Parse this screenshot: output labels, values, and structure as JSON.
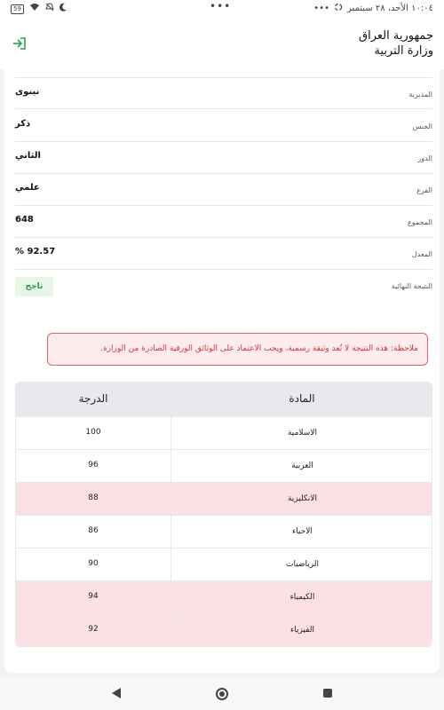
{
  "status_bar": {
    "battery": "59",
    "time_date": "١٠:٠٤ الأحد، ٢٨ سبتمبر",
    "dots": "•••"
  },
  "header": {
    "line1": "جمهورية العراق",
    "line2": "وزارة التربية"
  },
  "info": [
    {
      "label": "المديرية",
      "value": "نينوى"
    },
    {
      "label": "الجنس",
      "value": "ذكر"
    },
    {
      "label": "الدور",
      "value": "الثاني"
    },
    {
      "label": "الفرع",
      "value": "علمي"
    },
    {
      "label": "المجموع",
      "value": "648"
    },
    {
      "label": "المعدل",
      "value": "92.57 %"
    }
  ],
  "final_result": {
    "label": "النتيجة النهائية",
    "value": "ناجح"
  },
  "note": "ملاحظة: هذه النتيجة لا تُعد وثيقة رسمية، ويجب الاعتماد على الوثائق الورقية الصادرة من الوزارة.",
  "table": {
    "header_subject": "المادة",
    "header_grade": "الدرجة",
    "rows": [
      {
        "subject": "الاسلامية",
        "grade": "100",
        "highlight": false
      },
      {
        "subject": "العربية",
        "grade": "96",
        "highlight": false
      },
      {
        "subject": "الانكليزية",
        "grade": "88",
        "highlight": true
      },
      {
        "subject": "الاحياء",
        "grade": "86",
        "highlight": false
      },
      {
        "subject": "الرياضيات",
        "grade": "90",
        "highlight": false
      },
      {
        "subject": "الكيمياء",
        "grade": "94",
        "highlight": true
      },
      {
        "subject": "الفيزياء",
        "grade": "92",
        "highlight": true
      }
    ]
  },
  "colors": {
    "accent": "#2e9d4b",
    "alert": "#d0343e",
    "highlight_row": "#fbe1e3"
  },
  "icons": {
    "logout": "logout-icon",
    "back": "back-icon",
    "home": "home-icon",
    "recent": "recent-apps-icon"
  }
}
